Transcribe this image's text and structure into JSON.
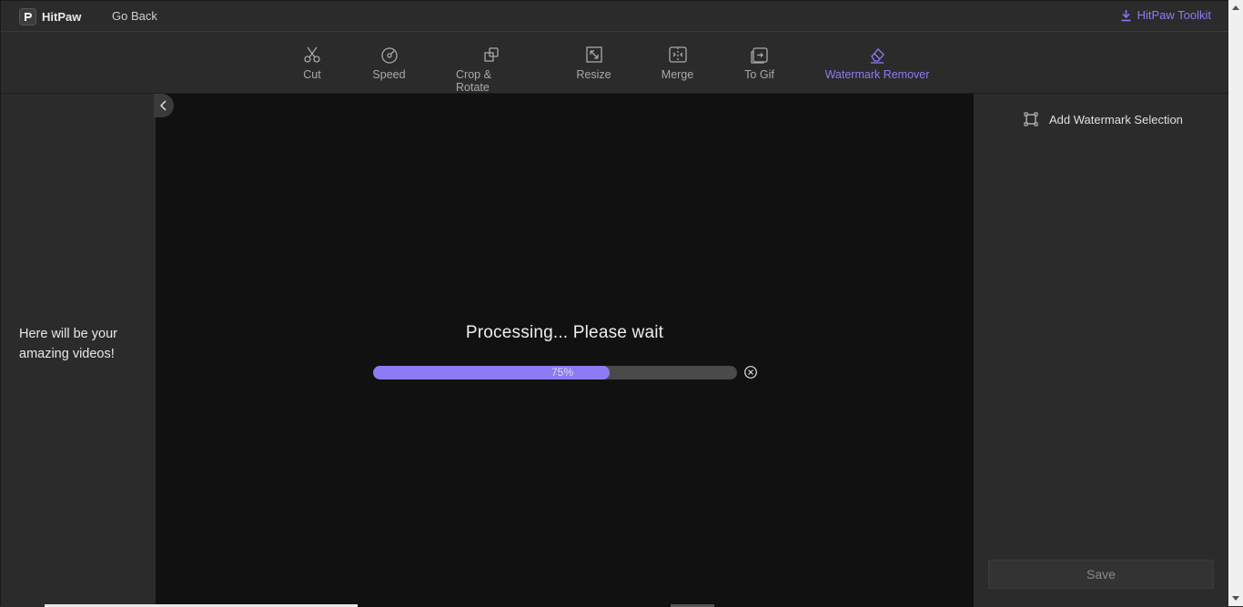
{
  "titlebar": {
    "brand_name": "HitPaw",
    "go_back": "Go Back",
    "toolkit_label": "HitPaw Toolkit"
  },
  "toolbar": {
    "tools": [
      {
        "label": "Cut",
        "icon": "scissors-icon"
      },
      {
        "label": "Speed",
        "icon": "speedometer-icon"
      },
      {
        "label": "Crop & Rotate",
        "icon": "crop-rotate-icon"
      },
      {
        "label": "Resize",
        "icon": "resize-icon"
      },
      {
        "label": "Merge",
        "icon": "merge-icon"
      },
      {
        "label": "To Gif",
        "icon": "to-gif-icon"
      },
      {
        "label": "Watermark Remover",
        "icon": "eraser-icon",
        "active": true
      }
    ]
  },
  "left_panel": {
    "placeholder_text": "Here will be your amazing videos!"
  },
  "preview": {
    "status_text": "Processing... Please wait",
    "progress": 0.65,
    "progress_label": "75%"
  },
  "right_panel": {
    "add_selection_label": "Add Watermark Selection",
    "save_label": "Save"
  },
  "colors": {
    "accent": "#8b7cf6",
    "background": "#2b2b2b",
    "preview_bg": "#111111"
  }
}
